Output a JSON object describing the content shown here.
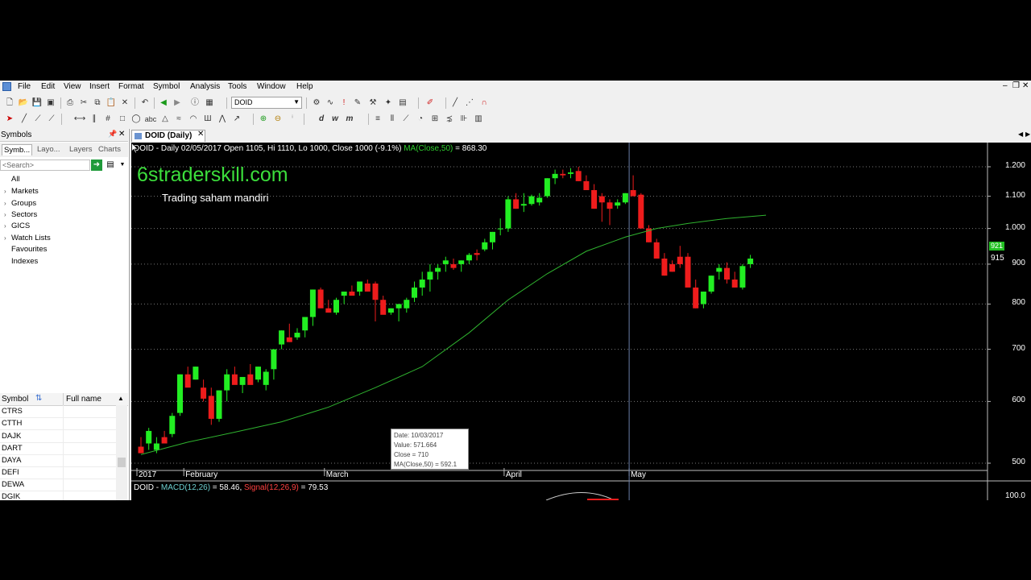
{
  "menu": [
    "File",
    "Edit",
    "View",
    "Insert",
    "Format",
    "Symbol",
    "Analysis",
    "Tools",
    "Window",
    "Help"
  ],
  "window_controls": {
    "minimize": "–",
    "restore": "❐",
    "close": "✕"
  },
  "toolbar": {
    "symbol_value": "DOID"
  },
  "left_panel": {
    "title": "Symbols",
    "tabs": [
      "Symb...",
      "Layo...",
      "Layers",
      "Charts"
    ],
    "search_placeholder": "<Search>",
    "tree": [
      "All",
      "Markets",
      "Groups",
      "Sectors",
      "GICS",
      "Watch Lists",
      "Favourites",
      "Indexes"
    ],
    "table_headers": {
      "symbol": "Symbol",
      "full_name": "Full name"
    },
    "rows": [
      "CTRS",
      "CTTH",
      "DAJK",
      "DART",
      "DAYA",
      "DEFI",
      "DEWA",
      "DGIK"
    ]
  },
  "chart_tab": {
    "label": "DOID (Daily)"
  },
  "chart_header": {
    "text": "DOID - Daily 02/05/2017 Open 1105, Hi 1110, Lo 1000, Close 1000 (-9.1%)",
    "ma_label": "MA(Close,50)",
    "ma_value": " = 868.30"
  },
  "watermark": "6straderskill.com",
  "subtitle": "Trading saham mandiri",
  "macd": {
    "prefix": "DOID - ",
    "macd_label": "MACD(12,26)",
    "macd_value": " = 58.46, ",
    "signal_label": "Signal(12,26,9)",
    "signal_value": " = 79.53"
  },
  "tooltip": {
    "date": "Date: 10/03/2017",
    "value": "Value: 571.664",
    "close": "Close = 710",
    "ma": "MA(Close,50) = 592.1"
  },
  "last_price_tag": "921",
  "last_price_label": "915",
  "macd_axis_top": "100.0",
  "colors": {
    "up": "#22ee22",
    "down": "#ee1c1c",
    "ma": "#2fb32f",
    "background": "#000000",
    "grid": "#777777"
  },
  "chart_data": {
    "type": "candlestick",
    "y_ticks": [
      {
        "v": 1200,
        "label": "1.200"
      },
      {
        "v": 1100,
        "label": "1.100"
      },
      {
        "v": 1000,
        "label": "1.000"
      },
      {
        "v": 900,
        "label": "900"
      },
      {
        "v": 800,
        "label": "800"
      },
      {
        "v": 700,
        "label": "700"
      },
      {
        "v": 600,
        "label": "600"
      },
      {
        "v": 500,
        "label": "500"
      }
    ],
    "scale": "log",
    "x_labels": [
      {
        "label": "2017",
        "i": 0
      },
      {
        "label": "February",
        "i": 6
      },
      {
        "label": "March",
        "i": 24
      },
      {
        "label": "April",
        "i": 47
      },
      {
        "label": "May",
        "i": 63
      }
    ],
    "cursor_index": 63,
    "candles": [
      [
        525,
        540,
        515,
        515
      ],
      [
        530,
        555,
        520,
        550
      ],
      [
        520,
        540,
        515,
        530
      ],
      [
        540,
        550,
        530,
        530
      ],
      [
        545,
        580,
        540,
        575
      ],
      [
        580,
        650,
        575,
        650
      ],
      [
        650,
        665,
        630,
        625
      ],
      [
        640,
        665,
        640,
        665
      ],
      [
        625,
        640,
        600,
        605
      ],
      [
        610,
        625,
        560,
        570
      ],
      [
        570,
        620,
        565,
        620
      ],
      [
        620,
        660,
        600,
        650
      ],
      [
        650,
        665,
        635,
        630
      ],
      [
        630,
        645,
        615,
        645
      ],
      [
        650,
        670,
        645,
        630
      ],
      [
        640,
        665,
        635,
        665
      ],
      [
        630,
        660,
        620,
        655
      ],
      [
        660,
        700,
        640,
        700
      ],
      [
        710,
        740,
        700,
        740
      ],
      [
        725,
        755,
        715,
        715
      ],
      [
        725,
        745,
        720,
        735
      ],
      [
        740,
        770,
        725,
        770
      ],
      [
        770,
        835,
        750,
        835
      ],
      [
        835,
        840,
        800,
        790
      ],
      [
        790,
        810,
        780,
        780
      ],
      [
        780,
        815,
        775,
        810
      ],
      [
        820,
        830,
        800,
        830
      ],
      [
        830,
        845,
        820,
        820
      ],
      [
        830,
        855,
        820,
        855
      ],
      [
        850,
        860,
        830,
        830
      ],
      [
        850,
        855,
        760,
        810
      ],
      [
        810,
        820,
        790,
        775
      ],
      [
        780,
        790,
        775,
        790
      ],
      [
        790,
        800,
        760,
        800
      ],
      [
        790,
        815,
        780,
        810
      ],
      [
        815,
        855,
        805,
        840
      ],
      [
        840,
        880,
        820,
        860
      ],
      [
        860,
        900,
        830,
        880
      ],
      [
        880,
        900,
        860,
        890
      ],
      [
        900,
        920,
        880,
        910
      ],
      [
        900,
        915,
        885,
        890
      ],
      [
        900,
        910,
        880,
        910
      ],
      [
        910,
        930,
        900,
        925
      ],
      [
        930,
        940,
        910,
        925
      ],
      [
        940,
        970,
        935,
        960
      ],
      [
        960,
        990,
        940,
        990
      ],
      [
        1000,
        1030,
        980,
        1000
      ],
      [
        1000,
        1100,
        990,
        1090
      ],
      [
        1090,
        1110,
        1060,
        1060
      ],
      [
        1070,
        1110,
        1050,
        1075
      ],
      [
        1075,
        1105,
        1070,
        1100
      ],
      [
        1080,
        1110,
        1070,
        1095
      ],
      [
        1100,
        1160,
        1095,
        1160
      ],
      [
        1160,
        1190,
        1140,
        1175
      ],
      [
        1175,
        1190,
        1160,
        1170
      ],
      [
        1175,
        1195,
        1160,
        1180
      ],
      [
        1185,
        1200,
        1150,
        1150
      ],
      [
        1150,
        1170,
        1120,
        1120
      ],
      [
        1120,
        1140,
        1060,
        1060
      ],
      [
        1100,
        1110,
        1020,
        1080
      ],
      [
        1080,
        1090,
        1010,
        1060
      ],
      [
        1070,
        1090,
        1060,
        1080
      ],
      [
        1080,
        1110,
        1075,
        1110
      ],
      [
        1120,
        1170,
        1100,
        1100
      ],
      [
        1105,
        1110,
        1000,
        1000
      ],
      [
        1000,
        1010,
        960,
        960
      ],
      [
        960,
        970,
        915,
        915
      ],
      [
        915,
        930,
        870,
        870
      ],
      [
        900,
        910,
        880,
        880
      ],
      [
        920,
        950,
        890,
        900
      ],
      [
        920,
        930,
        850,
        840
      ],
      [
        840,
        860,
        790,
        790
      ],
      [
        800,
        830,
        790,
        830
      ],
      [
        830,
        870,
        825,
        870
      ],
      [
        880,
        900,
        860,
        890
      ],
      [
        890,
        905,
        850,
        860
      ],
      [
        860,
        880,
        840,
        840
      ],
      [
        840,
        900,
        835,
        895
      ],
      [
        900,
        925,
        890,
        915
      ]
    ],
    "ma_points": [
      [
        0,
        513
      ],
      [
        6,
        532
      ],
      [
        12,
        548
      ],
      [
        18,
        565
      ],
      [
        24,
        590
      ],
      [
        30,
        625
      ],
      [
        36,
        665
      ],
      [
        42,
        735
      ],
      [
        47,
        810
      ],
      [
        52,
        875
      ],
      [
        57,
        935
      ],
      [
        62,
        975
      ],
      [
        66,
        1000
      ],
      [
        70,
        1015
      ],
      [
        75,
        1030
      ],
      [
        80,
        1040
      ]
    ]
  }
}
